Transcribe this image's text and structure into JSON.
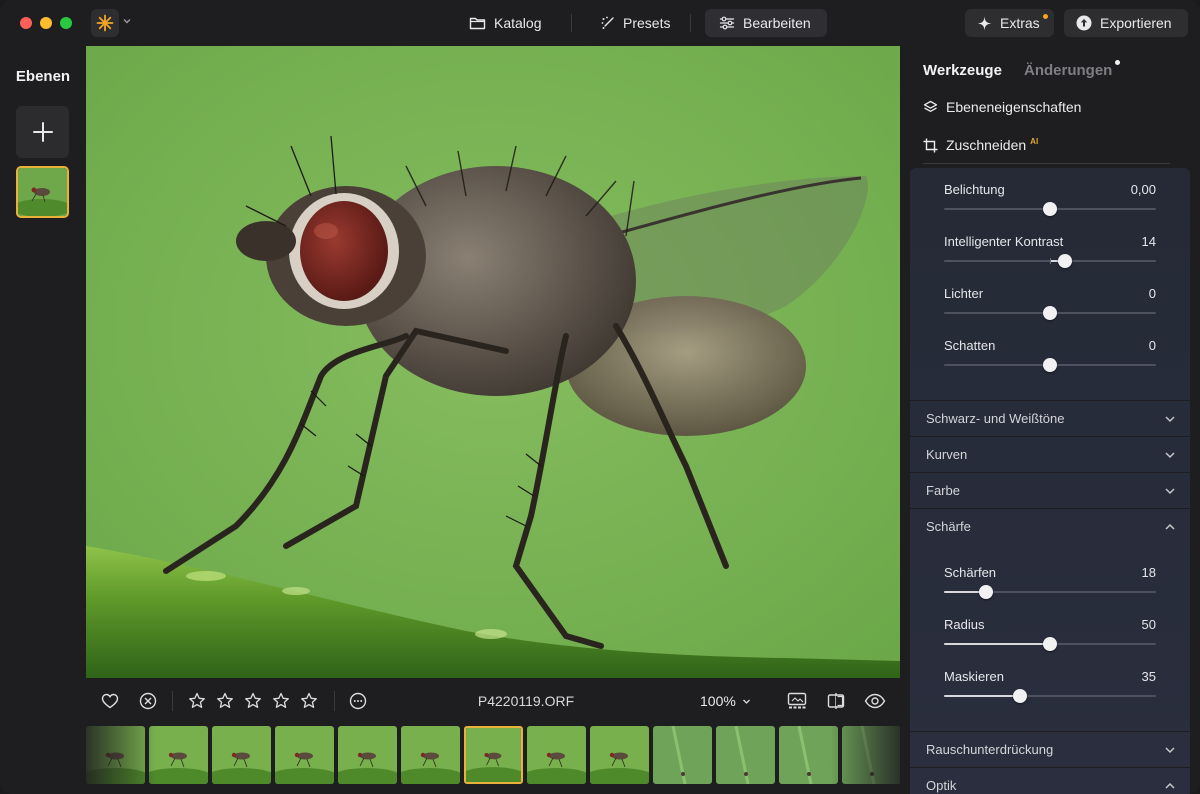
{
  "titlebar": {
    "nav": [
      {
        "label": "Katalog",
        "icon": "folder-icon"
      },
      {
        "label": "Presets",
        "icon": "sparkle-wand-icon"
      },
      {
        "label": "Bearbeiten",
        "icon": "sliders-icon",
        "active": true
      }
    ],
    "extras_label": "Extras",
    "export_label": "Exportieren",
    "accent_color": "#f5a623"
  },
  "left_panel": {
    "title": "Ebenen",
    "add_icon": "plus-icon"
  },
  "bottom_bar": {
    "filename": "P4220119.ORF",
    "zoom": "100%",
    "rating_stars": 5
  },
  "filmstrip": {
    "count": 13,
    "selected_index": 6
  },
  "right_panel": {
    "tabs": {
      "tools": "Werkzeuge",
      "changes": "Änderungen"
    },
    "layer_properties": "Ebeneneigenschaften",
    "crop": "Zuschneiden",
    "crop_badge": "AI",
    "sliders_top": [
      {
        "label": "Belichtung",
        "value": "0,00",
        "level": 0.5
      },
      {
        "label": "Intelligenter Kontrast",
        "value": "14",
        "level": 0.57
      },
      {
        "label": "Lichter",
        "value": "0",
        "level": 0.5
      },
      {
        "label": "Schatten",
        "value": "0",
        "level": 0.5
      }
    ],
    "sections": [
      {
        "label": "Schwarz- und Weißtöne",
        "expanded": false
      },
      {
        "label": "Kurven",
        "expanded": false
      },
      {
        "label": "Farbe",
        "expanded": false
      },
      {
        "label": "Schärfe",
        "expanded": true
      }
    ],
    "sharpness_sliders": [
      {
        "label": "Schärfen",
        "value": "18",
        "level": 0.2
      },
      {
        "label": "Radius",
        "value": "50",
        "level": 0.5
      },
      {
        "label": "Maskieren",
        "value": "35",
        "level": 0.36
      }
    ],
    "sections_bottom": [
      {
        "label": "Rauschunterdrückung",
        "expanded": false
      },
      {
        "label": "Optik",
        "expanded": true
      }
    ]
  }
}
